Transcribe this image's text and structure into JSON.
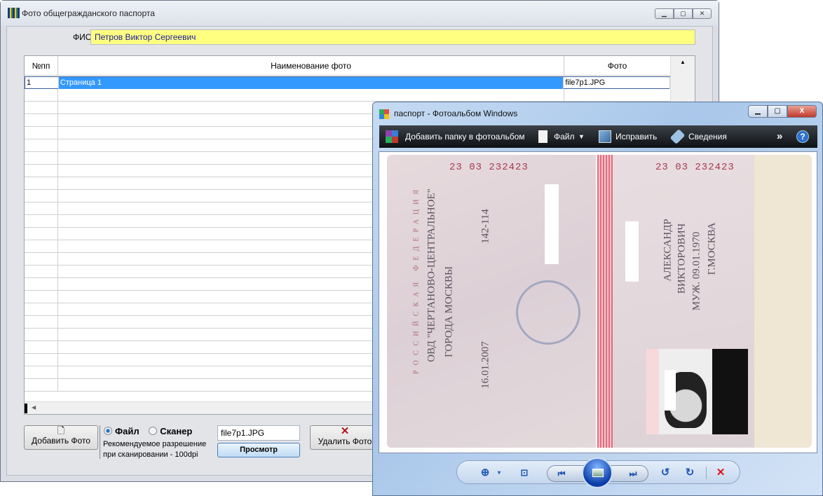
{
  "main_window": {
    "title": "Фото общегражданского паспорта",
    "fio_label": "ФИО",
    "fio_value": "Петров Виктор Сергеевич",
    "table": {
      "columns": [
        "№пп",
        "Наименование фото",
        "Фото"
      ],
      "rows": [
        {
          "num": "1",
          "name": "Страница 1",
          "photo": "file7p1.JPG"
        }
      ]
    },
    "add_photo_label": "Добавить Фото",
    "source_options": [
      "Файл",
      "Сканер"
    ],
    "selected_source": "Файл",
    "scan_hint_line1": "Рекомендуемое разрешение",
    "scan_hint_line2": "при сканировании - 100dpi",
    "file_value": "file7p1.JPG",
    "preview_label": "Просмотр",
    "delete_label": "Удалить Фото"
  },
  "viewer": {
    "title": "паспорт - Фотоальбом Windows",
    "toolbar": {
      "add_folder": "Добавить папку в фотоальбом",
      "file": "Файл",
      "fix": "Исправить",
      "info": "Сведения"
    },
    "passport": {
      "series": "23  03  232423",
      "country": "РОССИЙСКАЯ ФЕДЕРАЦИЯ",
      "issuer1": "ОВД \"ЧЕРТАНОВО-ЦЕНТРАЛЬНОЕ\"",
      "issuer2": "ГОРОДА МОСКВЫ",
      "issue_date": "16.01.2007",
      "dept_code": "142-114",
      "first_name": "АЛЕКСАНДР",
      "patronymic": "ВИКТОРОВИЧ",
      "sex_dob": "МУЖ.   09.01.1970",
      "birthplace": "Г.МОСКВА"
    }
  }
}
